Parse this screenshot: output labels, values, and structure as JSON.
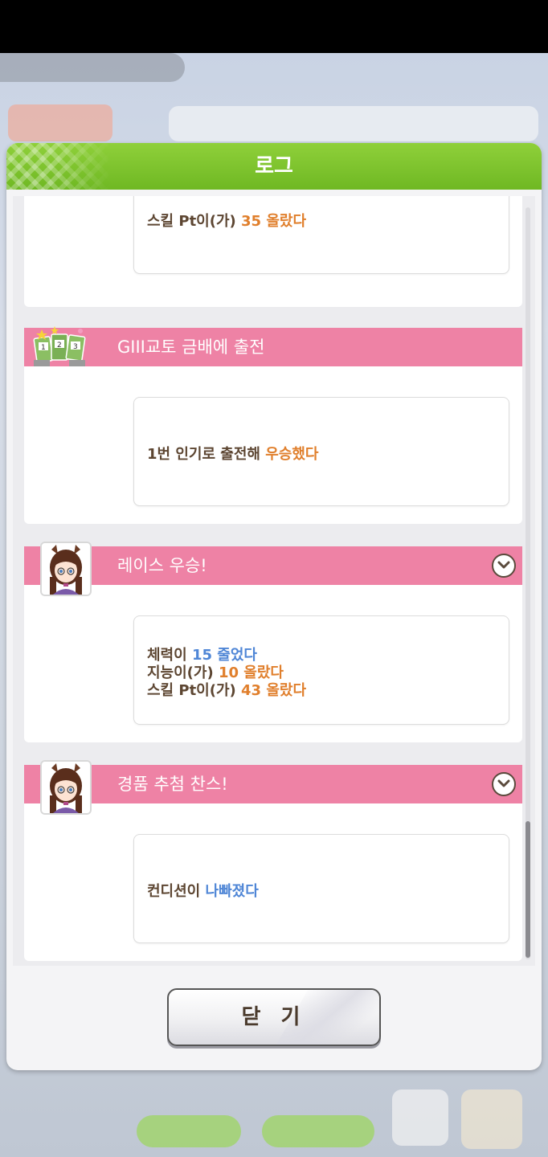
{
  "dialog": {
    "title": "로그",
    "close_label": "닫 기"
  },
  "log_entries": [
    {
      "title": "",
      "lines": [
        {
          "text": "스킬 Pt이(가) ",
          "value": "35 올랐다",
          "value_color": "orange"
        }
      ]
    },
    {
      "title": "GIII교토 금배에 출전",
      "icon": "race-cards-icon",
      "lines": [
        {
          "text": "1번 인기로 출전해 ",
          "value": "우승했다",
          "value_color": "orange"
        }
      ]
    },
    {
      "title": "레이스 우승!",
      "icon": "character-avatar",
      "expandable": true,
      "lines": [
        {
          "text": "체력이 ",
          "value": "15 줄었다",
          "value_color": "blue"
        },
        {
          "text": "지능이(가) ",
          "value": "10 올랐다",
          "value_color": "orange"
        },
        {
          "text": "스킬 Pt이(가) ",
          "value": "43 올랐다",
          "value_color": "orange"
        }
      ]
    },
    {
      "title": "경품 추첨 찬스!",
      "icon": "character-avatar",
      "expandable": true,
      "lines": [
        {
          "text": "컨디션이 ",
          "value": "나빠졌다",
          "value_color": "blue"
        }
      ]
    }
  ],
  "colors": {
    "header_green": "#7cc42e",
    "card_header_pink": "#ee82a5",
    "value_orange": "#e07f2c",
    "value_blue": "#4f86d6",
    "text_brown": "#5d4632"
  }
}
